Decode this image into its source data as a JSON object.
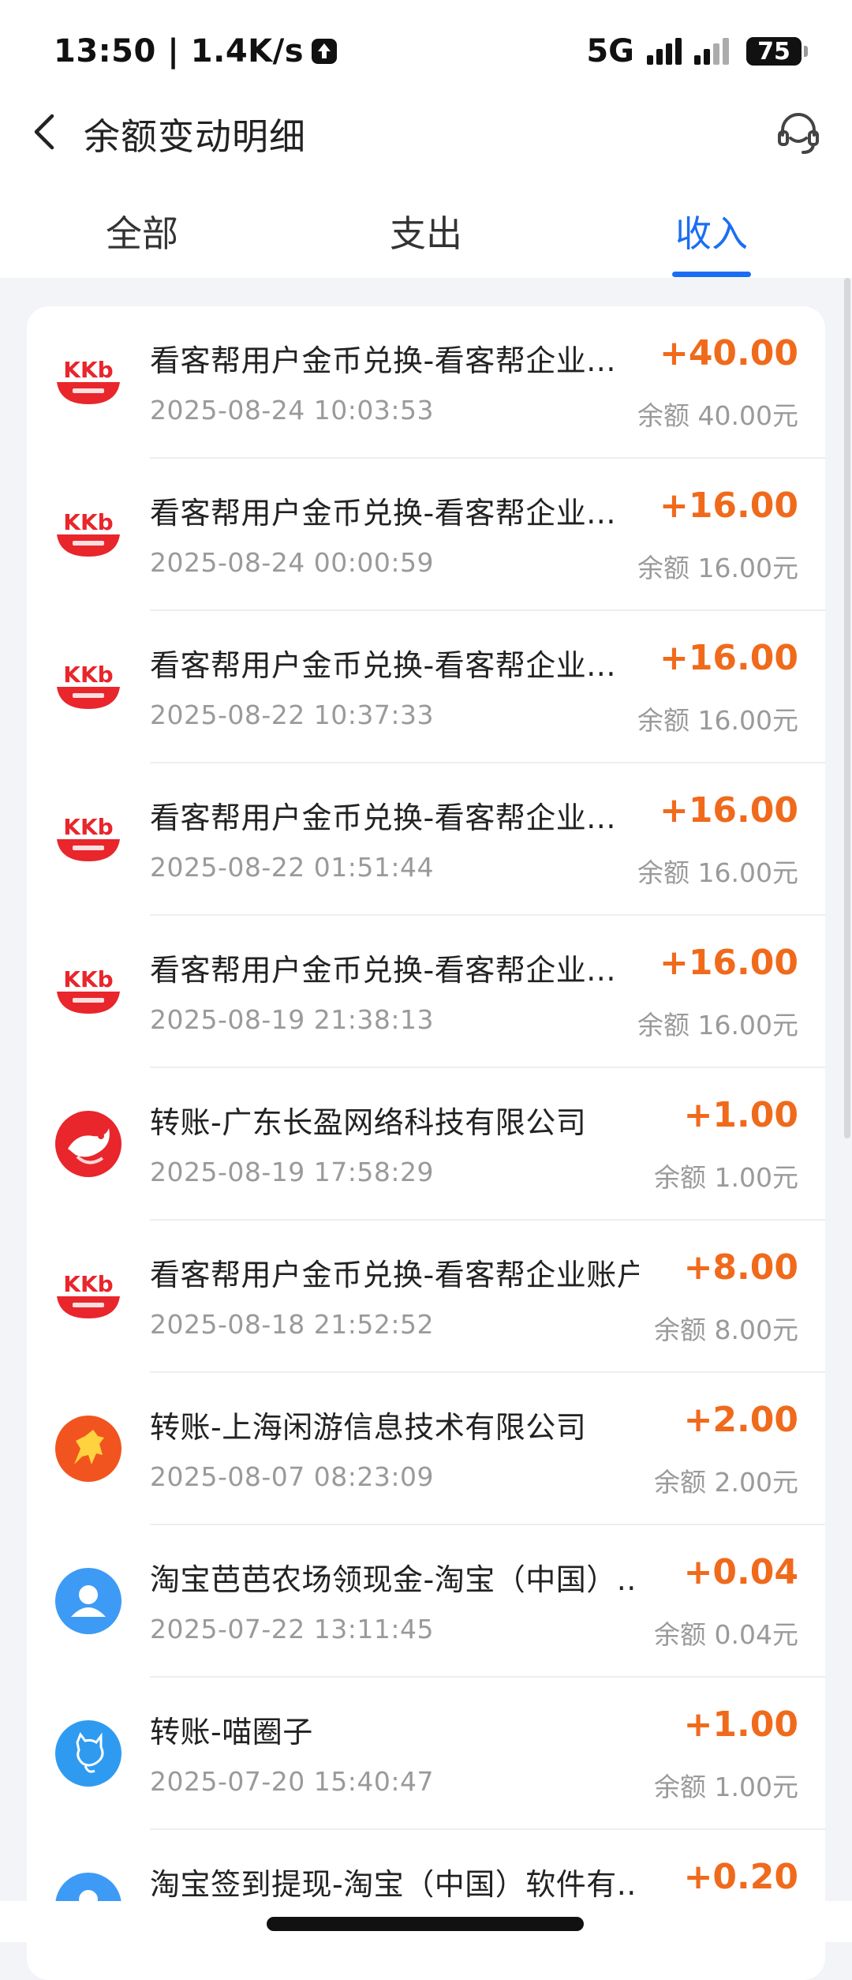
{
  "status_bar": {
    "time_speed": "13:50 | 1.4K/s",
    "network": "5G",
    "battery": "75"
  },
  "header": {
    "title": "余额变动明细",
    "back_icon": "chevron-left-icon",
    "service_icon": "headset-icon"
  },
  "tabs": [
    {
      "label": "全部",
      "active": false
    },
    {
      "label": "支出",
      "active": false
    },
    {
      "label": "收入",
      "active": true
    }
  ],
  "colors": {
    "accent": "#1b6ef3",
    "amount": "#f06a1c",
    "kkb_red": "#e8262c"
  },
  "records": [
    {
      "title": "看客帮用户金币兑换-看客帮企业...",
      "time": "2025-08-24 10:03:53",
      "amount": "+40.00",
      "balance": "余额 40.00元",
      "icon": "kkb-logo-icon"
    },
    {
      "title": "看客帮用户金币兑换-看客帮企业...",
      "time": "2025-08-24 00:00:59",
      "amount": "+16.00",
      "balance": "余额 16.00元",
      "icon": "kkb-logo-icon"
    },
    {
      "title": "看客帮用户金币兑换-看客帮企业...",
      "time": "2025-08-22 10:37:33",
      "amount": "+16.00",
      "balance": "余额 16.00元",
      "icon": "kkb-logo-icon"
    },
    {
      "title": "看客帮用户金币兑换-看客帮企业...",
      "time": "2025-08-22 01:51:44",
      "amount": "+16.00",
      "balance": "余额 16.00元",
      "icon": "kkb-logo-icon"
    },
    {
      "title": "看客帮用户金币兑换-看客帮企业...",
      "time": "2025-08-19 21:38:13",
      "amount": "+16.00",
      "balance": "余额 16.00元",
      "icon": "kkb-logo-icon"
    },
    {
      "title": "转账-广东长盈网络科技有限公司",
      "time": "2025-08-19 17:58:29",
      "amount": "+1.00",
      "balance": "余额 1.00元",
      "icon": "bird-logo-icon"
    },
    {
      "title": "看客帮用户金币兑换-看客帮企业账户",
      "time": "2025-08-18 21:52:52",
      "amount": "+8.00",
      "balance": "余额 8.00元",
      "icon": "kkb-logo-icon"
    },
    {
      "title": "转账-上海闲游信息技术有限公司",
      "time": "2025-08-07 08:23:09",
      "amount": "+2.00",
      "balance": "余额 2.00元",
      "icon": "horse-logo-icon"
    },
    {
      "title": "淘宝芭芭农场领现金-淘宝（中国）...",
      "time": "2025-07-22 13:11:45",
      "amount": "+0.04",
      "balance": "余额 0.04元",
      "icon": "user-avatar-icon"
    },
    {
      "title": "转账-喵圈子",
      "time": "2025-07-20 15:40:47",
      "amount": "+1.00",
      "balance": "余额 1.00元",
      "icon": "cat-logo-icon"
    },
    {
      "title": "淘宝签到提现-淘宝（中国）软件有...",
      "time": "",
      "amount": "+0.20",
      "balance": "",
      "icon": "user-avatar-icon"
    }
  ]
}
